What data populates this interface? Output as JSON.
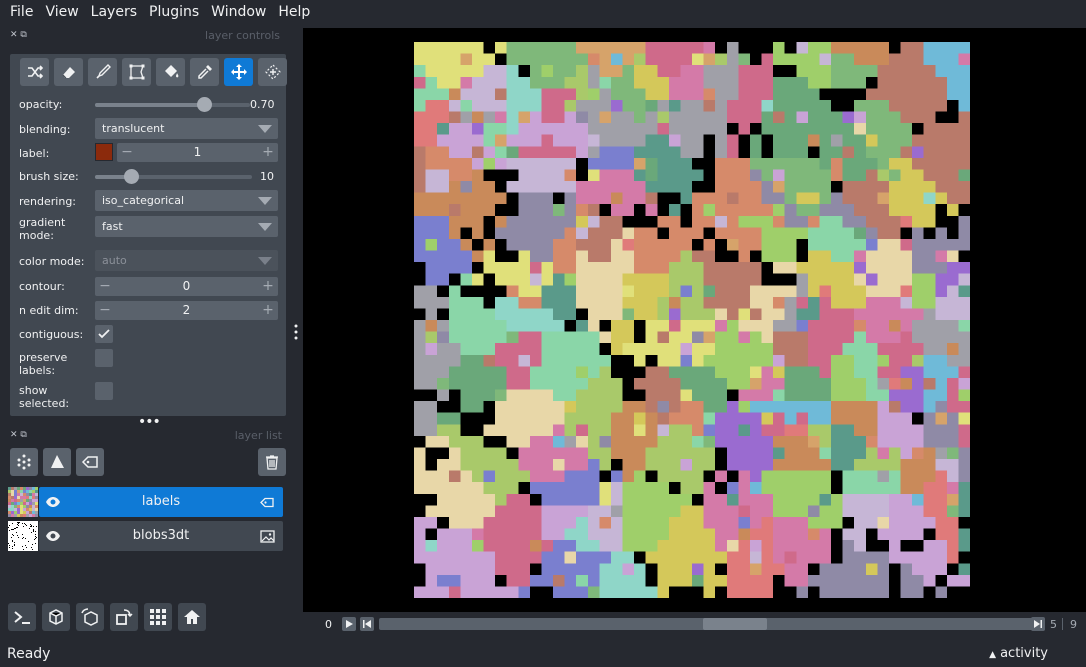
{
  "menubar": {
    "items": [
      "File",
      "View",
      "Layers",
      "Plugins",
      "Window",
      "Help"
    ]
  },
  "layer_controls": {
    "title": "layer controls",
    "opacity": {
      "label": "opacity:",
      "value": 0.7,
      "value_text": "0.70"
    },
    "blending": {
      "label": "blending:",
      "value": "translucent"
    },
    "label": {
      "label": "label:",
      "value": "1",
      "color": "#8b2a0c"
    },
    "brush_size": {
      "label": "brush size:",
      "value": 10,
      "max": 40,
      "value_text": "10"
    },
    "rendering": {
      "label": "rendering:",
      "value": "iso_categorical"
    },
    "gradient_mode": {
      "label": "gradient\nmode:",
      "value": "fast"
    },
    "color_mode": {
      "label": "color mode:",
      "value": "auto"
    },
    "contour": {
      "label": "contour:",
      "value": "0"
    },
    "n_edit_dim": {
      "label": "n edit dim:",
      "value": "2"
    },
    "contiguous": {
      "label": "contiguous:",
      "checked": true
    },
    "preserve_labels": {
      "label": "preserve\nlabels:",
      "checked": false
    },
    "show_selected": {
      "label": "show\nselected:",
      "checked": false
    }
  },
  "layer_list": {
    "title": "layer list",
    "layers": [
      {
        "name": "labels",
        "selected": true,
        "visible": true,
        "type_icon": "label-tag-icon"
      },
      {
        "name": "blobs3dt",
        "selected": false,
        "visible": true,
        "type_icon": "image-icon"
      }
    ]
  },
  "dims": {
    "axis_frame": "0",
    "current": "5",
    "max": "9"
  },
  "status": {
    "text": "Ready",
    "activity": "activity"
  },
  "colors": {
    "accent": "#0f7ad6",
    "background": "#262930",
    "panel": "#414851",
    "widget": "#5a626c"
  }
}
